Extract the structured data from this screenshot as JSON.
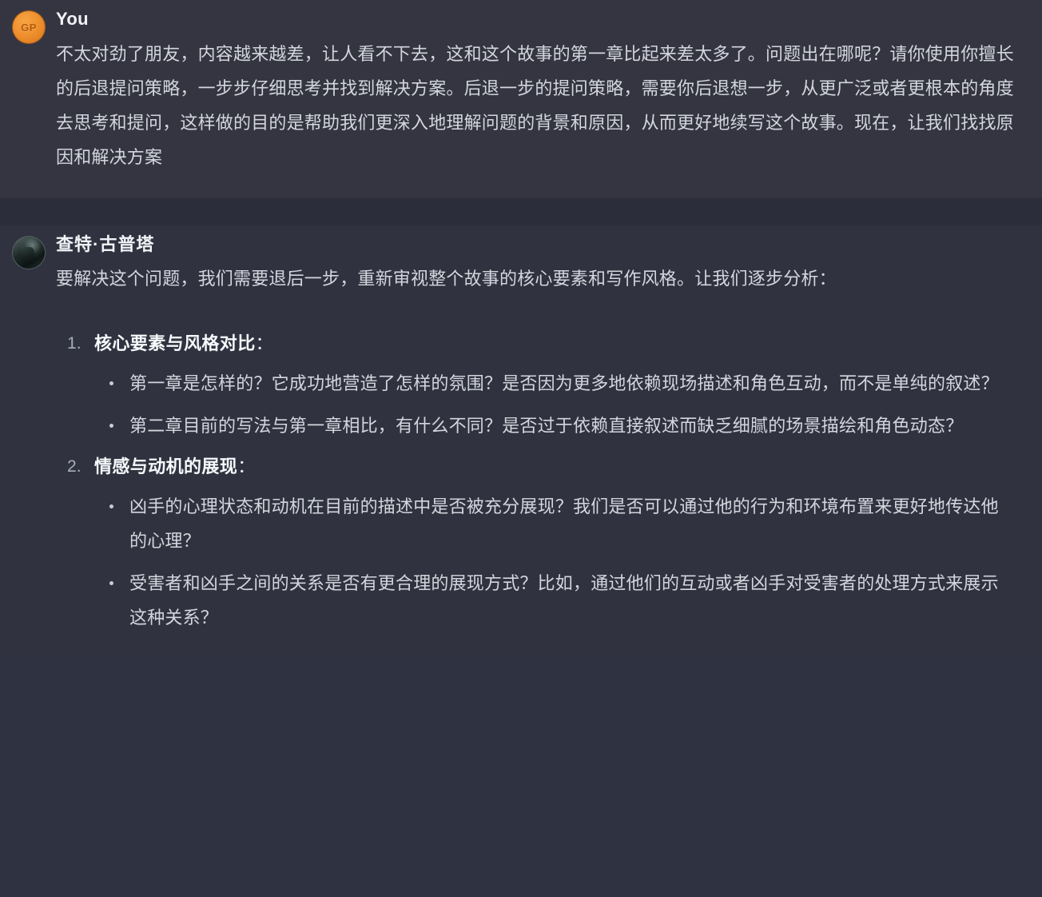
{
  "theme": {
    "background": "#2f3241",
    "user_bubble_bg": "#343541",
    "assistant_bubble_bg": "#30333f",
    "text_color": "#d4d6de",
    "heading_color": "#f2f3f7",
    "user_avatar_color": "#f0912f"
  },
  "messages": {
    "user": {
      "author": "You",
      "avatar_initials": "GP",
      "avatar_icon": "user-avatar-icon",
      "text": "不太对劲了朋友，内容越来越差，让人看不下去，这和这个故事的第一章比起来差太多了。问题出在哪呢？请你使用你擅长的后退提问策略，一步步仔细思考并找到解决方案。后退一步的提问策略，需要你后退想一步，从更广泛或者更根本的角度去思考和提问，这样做的目的是帮助我们更深入地理解问题的背景和原因，从而更好地续写这个故事。现在，让我们找找原因和解决方案"
    },
    "assistant": {
      "author": "查特·古普塔",
      "avatar_icon": "assistant-avatar-icon",
      "intro": "要解决这个问题，我们需要退后一步，重新审视整个故事的核心要素和写作风格。让我们逐步分析：",
      "steps": [
        {
          "number": "1.",
          "title_bold": "核心要素与风格对比",
          "title_suffix": "：",
          "bullets": [
            "第一章是怎样的？它成功地营造了怎样的氛围？是否因为更多地依赖现场描述和角色互动，而不是单纯的叙述？",
            "第二章目前的写法与第一章相比，有什么不同？是否过于依赖直接叙述而缺乏细腻的场景描绘和角色动态？"
          ]
        },
        {
          "number": "2.",
          "title_bold": "情感与动机的展现",
          "title_suffix": "：",
          "bullets": [
            "凶手的心理状态和动机在目前的描述中是否被充分展现？我们是否可以通过他的行为和环境布置来更好地传达他的心理？",
            "受害者和凶手之间的关系是否有更合理的展现方式？比如，通过他们的互动或者凶手对受害者的处理方式来展示这种关系？"
          ]
        }
      ]
    }
  }
}
